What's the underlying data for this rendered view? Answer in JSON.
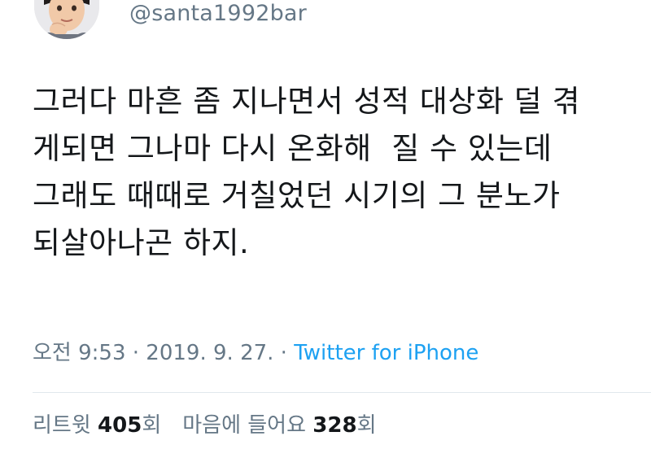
{
  "header": {
    "handle": "@santa1992bar",
    "avatar_icon": "animoji-avatar-icon"
  },
  "tweet": {
    "lines": [
      "그러다 마흔 좀 지나면서 성적 대상화 덜 겪",
      "게되면 그나마 다시 온화해  질 수 있는데",
      "그래도 때때로 거칠었던 시기의 그 분노가",
      "되살아나곤 하지."
    ]
  },
  "meta": {
    "time": "오전 9:53",
    "sep1": " · ",
    "date": "2019. 9. 27.",
    "sep2": " · ",
    "source": "Twitter for iPhone"
  },
  "stats": {
    "retweets_label": "리트윗",
    "retweets_count": "405",
    "retweets_suffix": "회",
    "likes_label": "마음에 들어요",
    "likes_count": "328",
    "likes_suffix": "회"
  },
  "colors": {
    "text": "#14171a",
    "secondary": "#657786",
    "link": "#1da1f2",
    "divider": "#e1e8ed"
  }
}
